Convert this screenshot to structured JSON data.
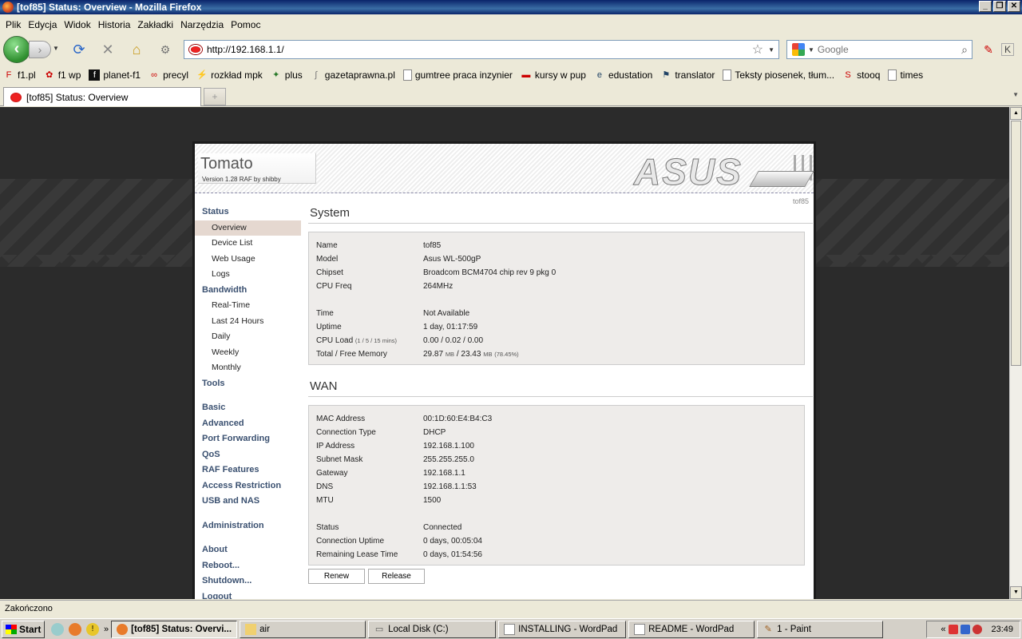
{
  "window": {
    "title": "[tof85] Status: Overview - Mozilla Firefox"
  },
  "menu": [
    "Plik",
    "Edycja",
    "Widok",
    "Historia",
    "Zakładki",
    "Narzędzia",
    "Pomoc"
  ],
  "nav": {
    "url": "http://192.168.1.1/",
    "search_placeholder": "Google"
  },
  "bookmarks": [
    "f1.pl",
    "f1 wp",
    "planet-f1",
    "precyl",
    "rozkład mpk",
    "plus",
    "gazetaprawna.pl",
    "gumtree praca inzynier",
    "kursy w pup",
    "edustation",
    "translator",
    "Teksty piosenek, tłum...",
    "stooq",
    "times"
  ],
  "tab": {
    "label": "[tof85] Status: Overview"
  },
  "router": {
    "brand": "Tomato",
    "version": "Version 1.28 RAF by shibby",
    "logo_text": "ASUS",
    "hostname": "tof85"
  },
  "sidebar": {
    "status": "Status",
    "overview": "Overview",
    "device_list": "Device List",
    "web_usage": "Web Usage",
    "logs": "Logs",
    "bandwidth": "Bandwidth",
    "real_time": "Real-Time",
    "last_24": "Last 24 Hours",
    "daily": "Daily",
    "weekly": "Weekly",
    "monthly": "Monthly",
    "tools": "Tools",
    "basic": "Basic",
    "advanced": "Advanced",
    "port_forwarding": "Port Forwarding",
    "qos": "QoS",
    "raf_features": "RAF Features",
    "access_restriction": "Access Restriction",
    "usb_nas": "USB and NAS",
    "administration": "Administration",
    "about": "About",
    "reboot": "Reboot...",
    "shutdown": "Shutdown...",
    "logout": "Logout"
  },
  "system": {
    "title": "System",
    "name_label": "Name",
    "name": "tof85",
    "model_label": "Model",
    "model": "Asus WL-500gP",
    "chipset_label": "Chipset",
    "chipset": "Broadcom BCM4704 chip rev 9 pkg 0",
    "cpufreq_label": "CPU Freq",
    "cpufreq": "264MHz",
    "time_label": "Time",
    "time": "Not Available",
    "uptime_label": "Uptime",
    "uptime": "1 day, 01:17:59",
    "cpuload_label": "CPU Load",
    "cpuload_hint": "(1 / 5 / 15 mins)",
    "cpuload": "0.00 / 0.02 / 0.00",
    "memory_label": "Total / Free Memory",
    "mem_total": "29.87",
    "mem_free": "23.43",
    "mem_unit": "MB",
    "mem_pct": "(78.45%)"
  },
  "wan": {
    "title": "WAN",
    "mac_label": "MAC Address",
    "mac": "00:1D:60:E4:B4:C3",
    "conn_type_label": "Connection Type",
    "conn_type": "DHCP",
    "ip_label": "IP Address",
    "ip": "192.168.1.100",
    "subnet_label": "Subnet Mask",
    "subnet": "255.255.255.0",
    "gateway_label": "Gateway",
    "gateway": "192.168.1.1",
    "dns_label": "DNS",
    "dns": "192.168.1.1:53",
    "mtu_label": "MTU",
    "mtu": "1500",
    "status_label": "Status",
    "status": "Connected",
    "conn_uptime_label": "Connection Uptime",
    "conn_uptime": "0 days, 00:05:04",
    "lease_label": "Remaining Lease Time",
    "lease": "0 days, 01:54:56",
    "renew": "Renew",
    "release": "Release"
  },
  "statusbar": {
    "text": "Zakończono"
  },
  "taskbar": {
    "start": "Start",
    "tasks": [
      "[tof85] Status: Overvi...",
      "air",
      "Local Disk (C:)",
      "INSTALLING - WordPad",
      "README - WordPad",
      "1 - Paint"
    ],
    "clock": "23:49"
  }
}
